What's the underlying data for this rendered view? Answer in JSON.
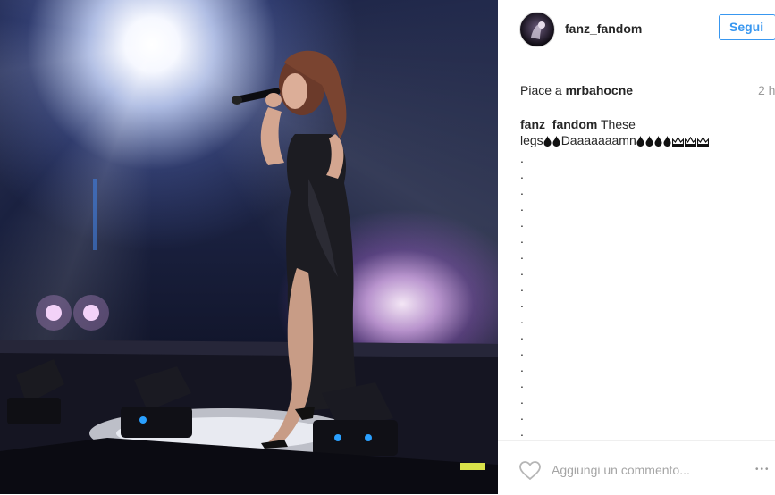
{
  "post": {
    "username": "fanz_fandom",
    "follow_label": "Segui",
    "likes_prefix": "Piace a",
    "liked_by": "mrbahocne",
    "time_ago": "2 h",
    "caption": {
      "user": "fanz_fandom",
      "text_line1": "These",
      "text_line2_start": "legs",
      "text_word": "Daaaaaaamn",
      "dots": [
        ".",
        ".",
        ".",
        ".",
        ".",
        ".",
        ".",
        ".",
        ".",
        ".",
        ".",
        ".",
        ".",
        ".",
        ".",
        ".",
        ".",
        "."
      ]
    },
    "comment_placeholder": "Aggiungi un commento...",
    "more_label": "•••",
    "icons": {
      "like": "heart-icon",
      "options": "more-options-icon",
      "fire": "fire-emoji-icon",
      "crown": "crown-emoji-icon"
    }
  }
}
